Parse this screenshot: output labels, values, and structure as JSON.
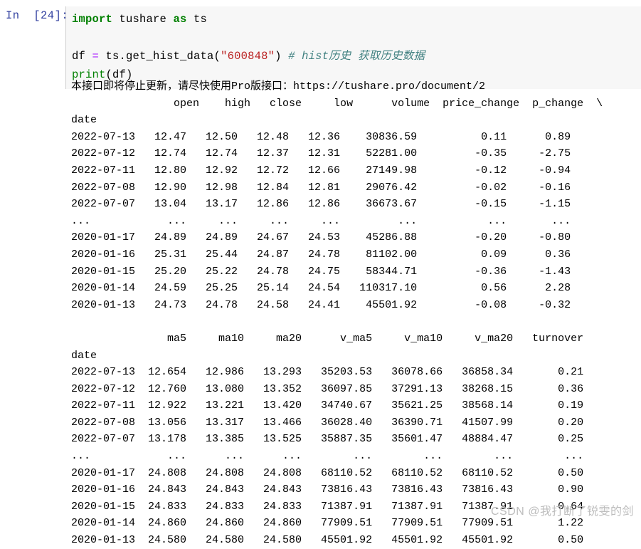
{
  "cell": {
    "prompt": "In  [24]:",
    "code": {
      "line1": {
        "kw_import": "import",
        "module": " tushare ",
        "kw_as": "as",
        "alias": " ts"
      },
      "line2": {
        "var": "df ",
        "op": "=",
        "call": " ts.get_hist_data(",
        "string": "\"600848\"",
        "close": ")",
        "comment": " # hist历史 获取历史数据"
      },
      "line3": {
        "builtin": "print",
        "args": "(df)"
      }
    }
  },
  "output": {
    "warning": "本接口即将停止更新，请尽快使用Pro版接口：https://tushare.pro/document/2",
    "block1": {
      "header": "                open    high   close     low      volume  price_change  p_change  \\",
      "index_label": "date",
      "rows": [
        "2022-07-13   12.47   12.50   12.48   12.36    30836.59          0.11      0.89",
        "2022-07-12   12.74   12.74   12.37   12.31    52281.00         -0.35     -2.75",
        "2022-07-11   12.80   12.92   12.72   12.66    27149.98         -0.12     -0.94",
        "2022-07-08   12.90   12.98   12.84   12.81    29076.42         -0.02     -0.16",
        "2022-07-07   13.04   13.17   12.86   12.86    36673.67         -0.15     -1.15",
        "...            ...     ...     ...     ...         ...           ...       ...",
        "2020-01-17   24.89   24.89   24.67   24.53    45286.88         -0.20     -0.80",
        "2020-01-16   25.31   25.44   24.87   24.78    81102.00          0.09      0.36",
        "2020-01-15   25.20   25.22   24.78   24.75    58344.71         -0.36     -1.43",
        "2020-01-14   24.59   25.25   25.14   24.54   110317.10          0.56      2.28",
        "2020-01-13   24.73   24.78   24.58   24.41    45501.92         -0.08     -0.32"
      ]
    },
    "block2": {
      "header": "               ma5     ma10     ma20      v_ma5     v_ma10     v_ma20   turnover",
      "index_label": "date",
      "rows": [
        "2022-07-13  12.654   12.986   13.293   35203.53   36078.66   36858.34       0.21",
        "2022-07-12  12.760   13.080   13.352   36097.85   37291.13   38268.15       0.36",
        "2022-07-11  12.922   13.221   13.420   34740.67   35621.25   38568.14       0.19",
        "2022-07-08  13.056   13.317   13.466   36028.40   36390.71   41507.99       0.20",
        "2022-07-07  13.178   13.385   13.525   35887.35   35601.47   48884.47       0.25",
        "...            ...      ...      ...        ...        ...        ...        ...",
        "2020-01-17  24.808   24.808   24.808   68110.52   68110.52   68110.52       0.50",
        "2020-01-16  24.843   24.843   24.843   73816.43   73816.43   73816.43       0.90",
        "2020-01-15  24.833   24.833   24.833   71387.91   71387.91   71387.91       0.64",
        "2020-01-14  24.860   24.860   24.860   77909.51   77909.51   77909.51       1.22",
        "2020-01-13  24.580   24.580   24.580   45501.92   45501.92   45501.92       0.50"
      ]
    }
  },
  "watermark": {
    "text": "CSDN @我打断了锐雯的剑"
  },
  "colors": {
    "prompt": "#303F9F",
    "keyword": "#008000",
    "operator": "#AA22FF",
    "string": "#BA2121",
    "comment": "#408080",
    "cell_background": "#f7f7f7",
    "watermark": "#bdbdbd"
  },
  "table_data": {
    "type": "table",
    "title": "ts.get_hist_data(\"600848\")",
    "block1_columns": [
      "date",
      "open",
      "high",
      "close",
      "low",
      "volume",
      "price_change",
      "p_change"
    ],
    "block1_values": [
      [
        "2022-07-13",
        12.47,
        12.5,
        12.48,
        12.36,
        30836.59,
        0.11,
        0.89
      ],
      [
        "2022-07-12",
        12.74,
        12.74,
        12.37,
        12.31,
        52281.0,
        -0.35,
        -2.75
      ],
      [
        "2022-07-11",
        12.8,
        12.92,
        12.72,
        12.66,
        27149.98,
        -0.12,
        -0.94
      ],
      [
        "2022-07-08",
        12.9,
        12.98,
        12.84,
        12.81,
        29076.42,
        -0.02,
        -0.16
      ],
      [
        "2022-07-07",
        13.04,
        13.17,
        12.86,
        12.86,
        36673.67,
        -0.15,
        -1.15
      ],
      [
        "2020-01-17",
        24.89,
        24.89,
        24.67,
        24.53,
        45286.88,
        -0.2,
        -0.8
      ],
      [
        "2020-01-16",
        25.31,
        25.44,
        24.87,
        24.78,
        81102.0,
        0.09,
        0.36
      ],
      [
        "2020-01-15",
        25.2,
        25.22,
        24.78,
        24.75,
        58344.71,
        -0.36,
        -1.43
      ],
      [
        "2020-01-14",
        24.59,
        25.25,
        25.14,
        24.54,
        110317.1,
        0.56,
        2.28
      ],
      [
        "2020-01-13",
        24.73,
        24.78,
        24.58,
        24.41,
        45501.92,
        -0.08,
        -0.32
      ]
    ],
    "block2_columns": [
      "date",
      "ma5",
      "ma10",
      "ma20",
      "v_ma5",
      "v_ma10",
      "v_ma20",
      "turnover"
    ],
    "block2_values": [
      [
        "2022-07-13",
        12.654,
        12.986,
        13.293,
        35203.53,
        36078.66,
        36858.34,
        0.21
      ],
      [
        "2022-07-12",
        12.76,
        13.08,
        13.352,
        36097.85,
        37291.13,
        38268.15,
        0.36
      ],
      [
        "2022-07-11",
        12.922,
        13.221,
        13.42,
        34740.67,
        35621.25,
        38568.14,
        0.19
      ],
      [
        "2022-07-08",
        13.056,
        13.317,
        13.466,
        36028.4,
        36390.71,
        41507.99,
        0.2
      ],
      [
        "2022-07-07",
        13.178,
        13.385,
        13.525,
        35887.35,
        35601.47,
        48884.47,
        0.25
      ],
      [
        "2020-01-17",
        24.808,
        24.808,
        24.808,
        68110.52,
        68110.52,
        68110.52,
        0.5
      ],
      [
        "2020-01-16",
        24.843,
        24.843,
        24.843,
        73816.43,
        73816.43,
        73816.43,
        0.9
      ],
      [
        "2020-01-15",
        24.833,
        24.833,
        24.833,
        71387.91,
        71387.91,
        71387.91,
        0.64
      ],
      [
        "2020-01-14",
        24.86,
        24.86,
        24.86,
        77909.51,
        77909.51,
        77909.51,
        1.22
      ],
      [
        "2020-01-13",
        24.58,
        24.58,
        24.58,
        45501.92,
        45501.92,
        45501.92,
        0.5
      ]
    ]
  }
}
